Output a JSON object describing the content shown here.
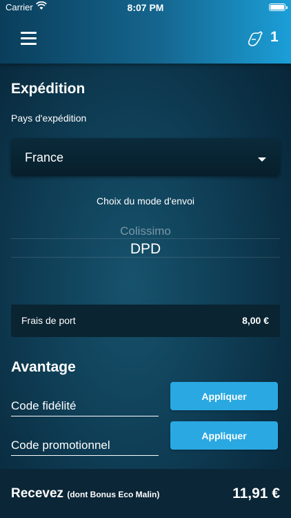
{
  "status_bar": {
    "carrier": "Carrier",
    "time": "8:07 PM"
  },
  "nav": {
    "cart_count": "1"
  },
  "shipping": {
    "title": "Expédition",
    "country_label": "Pays d'expédition",
    "country_value": "France",
    "mode_label": "Choix du mode d'envoi",
    "mode_options": [
      "Colissimo",
      "DPD"
    ],
    "mode_selected": "DPD",
    "fee_label": "Frais de port",
    "fee_value": "8,00 €"
  },
  "advantage": {
    "title": "Avantage",
    "loyalty_placeholder": "Code fidélité",
    "promo_placeholder": "Code promotionnel",
    "apply_label": "Appliquer"
  },
  "footer": {
    "receive_label": "Recevez",
    "receive_sub": "(dont Bonus Eco Malin)",
    "total": "11,91 €"
  },
  "colors": {
    "accent": "#2aa8e2",
    "nav_end": "#1b9fd8"
  },
  "icons": {
    "menu": "hamburger-menu-icon",
    "cart": "cart-icon",
    "wifi": "wifi-icon",
    "battery": "battery-icon",
    "caret": "chevron-down-icon"
  }
}
